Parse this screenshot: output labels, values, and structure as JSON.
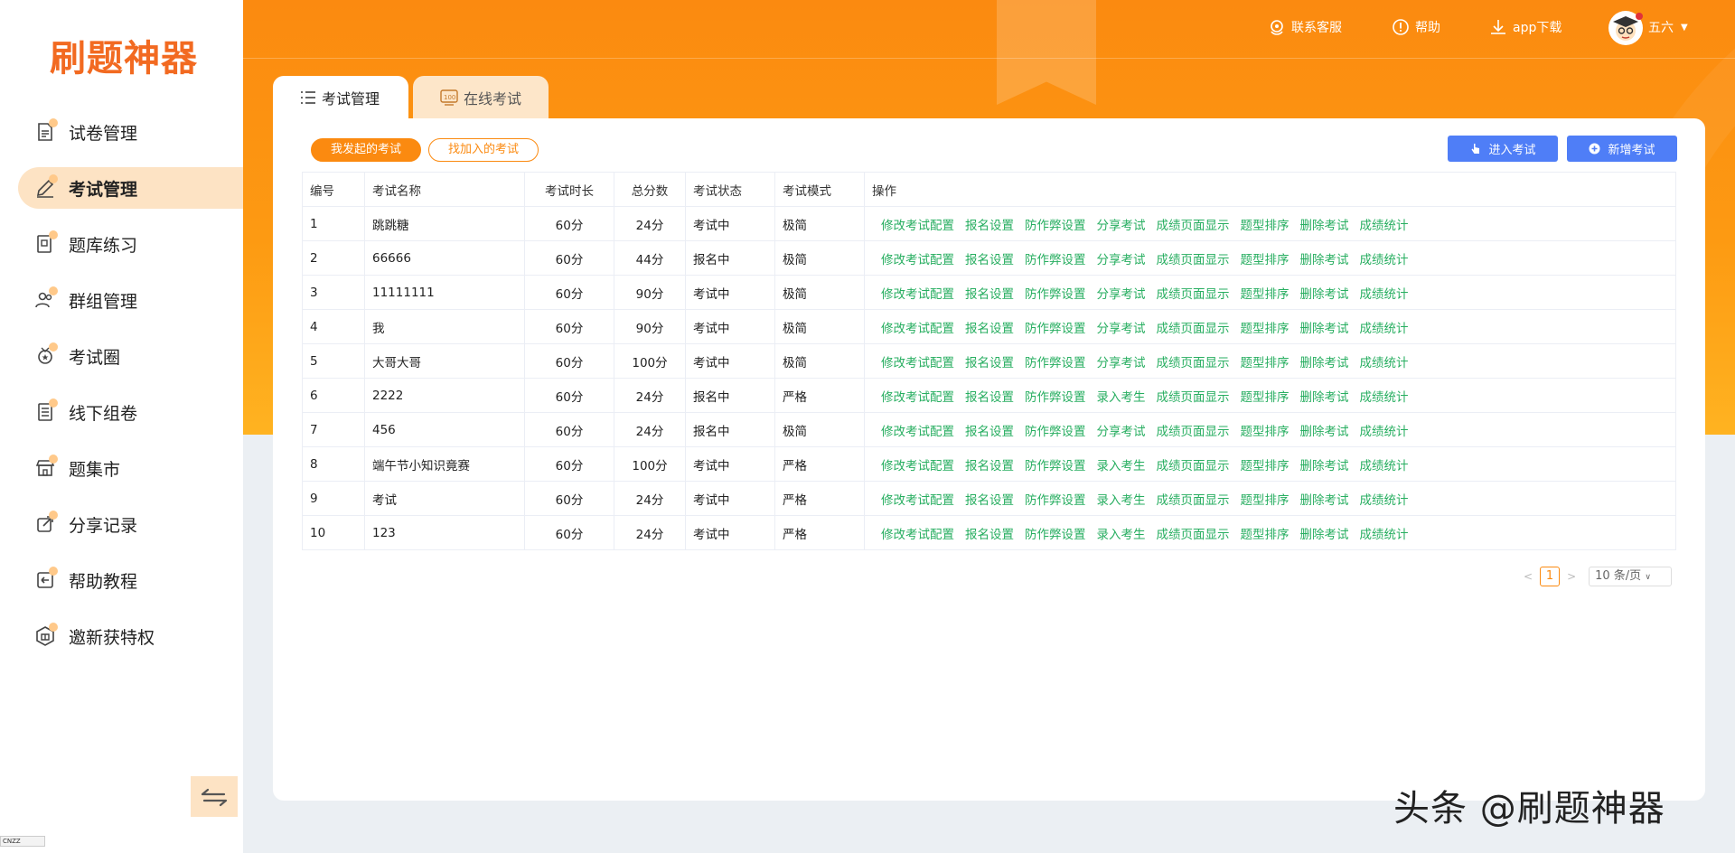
{
  "logo": "刷题神器",
  "sidebar": {
    "items": [
      {
        "label": "试卷管理",
        "icon": "document-icon"
      },
      {
        "label": "考试管理",
        "icon": "pencil-icon",
        "active": true
      },
      {
        "label": "题库练习",
        "icon": "book-icon"
      },
      {
        "label": "群组管理",
        "icon": "group-icon"
      },
      {
        "label": "考试圈",
        "icon": "medal-icon"
      },
      {
        "label": "线下组卷",
        "icon": "stack-icon"
      },
      {
        "label": "题集市",
        "icon": "store-icon"
      },
      {
        "label": "分享记录",
        "icon": "share-icon"
      },
      {
        "label": "帮助教程",
        "icon": "help-tutorial-icon"
      },
      {
        "label": "邀新获特权",
        "icon": "invite-icon"
      }
    ],
    "corner_badge": "CNZZ"
  },
  "topbar": {
    "contact": "联系客服",
    "help": "帮助",
    "app_download": "app下载",
    "username": "五六"
  },
  "tabs": {
    "exam_manage": "考试管理",
    "online_exam": "在线考试"
  },
  "filters": {
    "mine": "我发起的考试",
    "joined": "找加入的考试"
  },
  "actions": {
    "enter_exam": "进入考试",
    "new_exam": "新增考试"
  },
  "table": {
    "headers": [
      "编号",
      "考试名称",
      "考试时长",
      "总分数",
      "考试状态",
      "考试模式",
      "操作"
    ],
    "rows": [
      {
        "id": "1",
        "name": "跳跳糖",
        "duration": "60分",
        "score": "24分",
        "status": "考试中",
        "mode": "极简",
        "ops": [
          "修改考试配置",
          "报名设置",
          "防作弊设置",
          "分享考试",
          "成绩页面显示",
          "题型排序",
          "删除考试",
          "成绩统计"
        ]
      },
      {
        "id": "2",
        "name": "66666",
        "duration": "60分",
        "score": "44分",
        "status": "报名中",
        "mode": "极简",
        "ops": [
          "修改考试配置",
          "报名设置",
          "防作弊设置",
          "分享考试",
          "成绩页面显示",
          "题型排序",
          "删除考试",
          "成绩统计"
        ]
      },
      {
        "id": "3",
        "name": "11111111",
        "duration": "60分",
        "score": "90分",
        "status": "考试中",
        "mode": "极简",
        "ops": [
          "修改考试配置",
          "报名设置",
          "防作弊设置",
          "分享考试",
          "成绩页面显示",
          "题型排序",
          "删除考试",
          "成绩统计"
        ]
      },
      {
        "id": "4",
        "name": "我",
        "duration": "60分",
        "score": "90分",
        "status": "考试中",
        "mode": "极简",
        "ops": [
          "修改考试配置",
          "报名设置",
          "防作弊设置",
          "分享考试",
          "成绩页面显示",
          "题型排序",
          "删除考试",
          "成绩统计"
        ]
      },
      {
        "id": "5",
        "name": "大哥大哥",
        "duration": "60分",
        "score": "100分",
        "status": "考试中",
        "mode": "极简",
        "ops": [
          "修改考试配置",
          "报名设置",
          "防作弊设置",
          "分享考试",
          "成绩页面显示",
          "题型排序",
          "删除考试",
          "成绩统计"
        ]
      },
      {
        "id": "6",
        "name": "2222",
        "duration": "60分",
        "score": "24分",
        "status": "报名中",
        "mode": "严格",
        "ops": [
          "修改考试配置",
          "报名设置",
          "防作弊设置",
          "录入考生",
          "成绩页面显示",
          "题型排序",
          "删除考试",
          "成绩统计"
        ]
      },
      {
        "id": "7",
        "name": "456",
        "duration": "60分",
        "score": "24分",
        "status": "报名中",
        "mode": "极简",
        "ops": [
          "修改考试配置",
          "报名设置",
          "防作弊设置",
          "分享考试",
          "成绩页面显示",
          "题型排序",
          "删除考试",
          "成绩统计"
        ]
      },
      {
        "id": "8",
        "name": "端午节小知识竟赛",
        "duration": "60分",
        "score": "100分",
        "status": "考试中",
        "mode": "严格",
        "ops": [
          "修改考试配置",
          "报名设置",
          "防作弊设置",
          "录入考生",
          "成绩页面显示",
          "题型排序",
          "删除考试",
          "成绩统计"
        ]
      },
      {
        "id": "9",
        "name": "考试",
        "duration": "60分",
        "score": "24分",
        "status": "考试中",
        "mode": "严格",
        "ops": [
          "修改考试配置",
          "报名设置",
          "防作弊设置",
          "录入考生",
          "成绩页面显示",
          "题型排序",
          "删除考试",
          "成绩统计"
        ]
      },
      {
        "id": "10",
        "name": "123",
        "duration": "60分",
        "score": "24分",
        "status": "考试中",
        "mode": "严格",
        "ops": [
          "修改考试配置",
          "报名设置",
          "防作弊设置",
          "录入考生",
          "成绩页面显示",
          "题型排序",
          "删除考试",
          "成绩统计"
        ]
      }
    ]
  },
  "pagination": {
    "current": "1",
    "page_size": "10 条/页"
  },
  "watermark": "头条 @刷题神器",
  "colors": {
    "brand_orange": "#fb8a10",
    "active_nav_bg": "#fde3c4",
    "status_green": "#27ae60",
    "button_blue": "#4f7ef7"
  }
}
